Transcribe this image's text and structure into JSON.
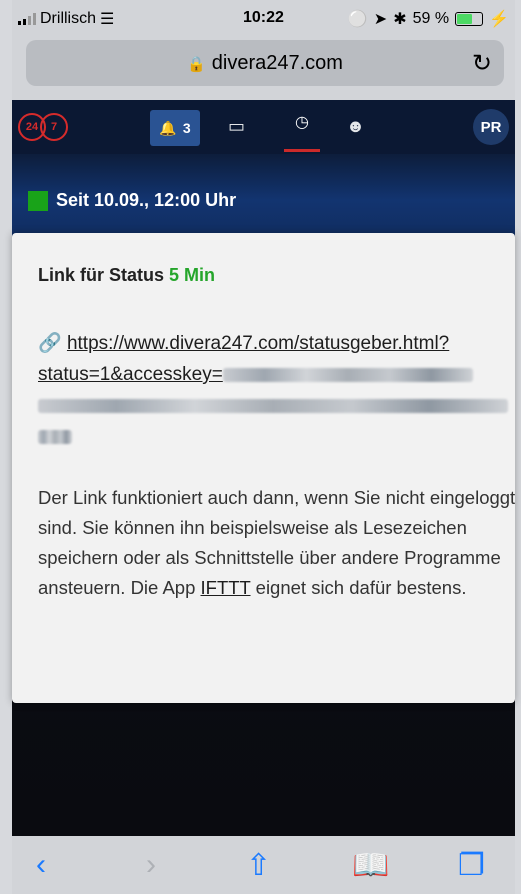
{
  "statusbar": {
    "carrier": "Drillisch",
    "time": "10:22",
    "battery_label": "59 %",
    "icons": [
      "wifi-icon",
      "lock-rotation-icon",
      "location-icon",
      "bluetooth-icon",
      "charging-icon"
    ]
  },
  "browser": {
    "url": "divera247.com"
  },
  "app": {
    "logo_left": "24",
    "logo_right": "7",
    "nav": {
      "alarm_count": "3",
      "avatar_initials": "PR"
    },
    "status_since": "Seit 10.09., 12:00 Uhr",
    "status_color": "#19a319"
  },
  "modal": {
    "title_prefix": "Link für Status",
    "title_accent": "5 Min",
    "accent_color": "#25a52b",
    "link_line1": "https://www.divera247.com/statusgeber.html?",
    "link_line2_prefix": "status=1&accesskey=",
    "description_before": "Der Link funktioniert auch dann, wenn Sie nicht eingeloggt sind. Sie können ihn beispielsweise als Lesezeichen speichern oder als Schnittstelle über andere Programme ansteuern. Die App",
    "ifttt": "IFTTT",
    "description_after": "eignet sich dafür bestens."
  },
  "toolbar": {
    "icons": [
      "back-icon",
      "forward-icon",
      "share-icon",
      "bookmarks-icon",
      "tabs-icon"
    ]
  }
}
